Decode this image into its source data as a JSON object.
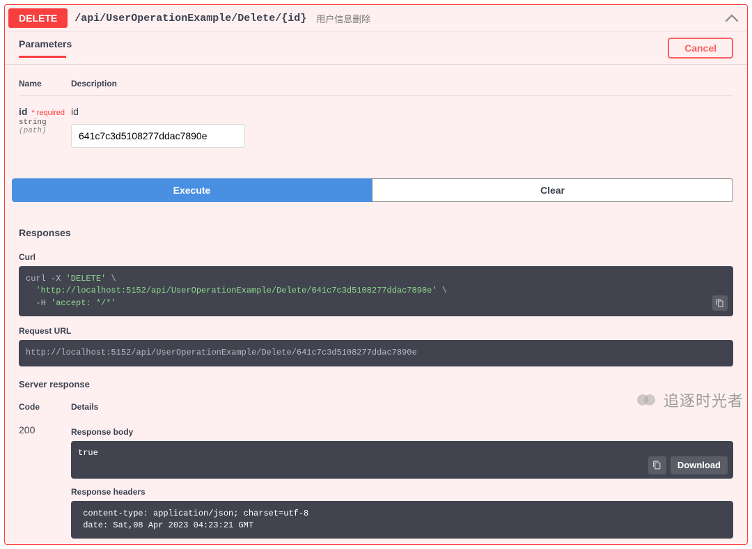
{
  "operation": {
    "method": "DELETE",
    "path": "/api/UserOperationExample/Delete/{id}",
    "summary": "用户信息删除"
  },
  "tabs": {
    "parameters": "Parameters",
    "cancel": "Cancel"
  },
  "param_headers": {
    "name": "Name",
    "description": "Description"
  },
  "param": {
    "name": "id",
    "required": "* required",
    "type": "string",
    "in": "(path)",
    "description": "id",
    "value": "641c7c3d5108277ddac7890e"
  },
  "actions": {
    "execute": "Execute",
    "clear": "Clear"
  },
  "responses_title": "Responses",
  "curl": {
    "label": "Curl",
    "prefix": "curl -X ",
    "method": "'DELETE'",
    "cont": " \\",
    "url": "'http://localhost:5152/api/UserOperationExample/Delete/641c7c3d5108277ddac7890e'",
    "header_flag": "-H ",
    "header": "'accept: */*'"
  },
  "request_url": {
    "label": "Request URL",
    "value": "http://localhost:5152/api/UserOperationExample/Delete/641c7c3d5108277ddac7890e"
  },
  "server_response": "Server response",
  "resp_headers": {
    "code": "Code",
    "details": "Details"
  },
  "response": {
    "code": "200",
    "body_label": "Response body",
    "body_value": "true",
    "download": "Download",
    "headers_label": "Response headers",
    "headers_value": " content-type: application/json; charset=utf-8 \n date: Sat,08 Apr 2023 04:23:21 GMT "
  },
  "watermark": "追逐时光者"
}
